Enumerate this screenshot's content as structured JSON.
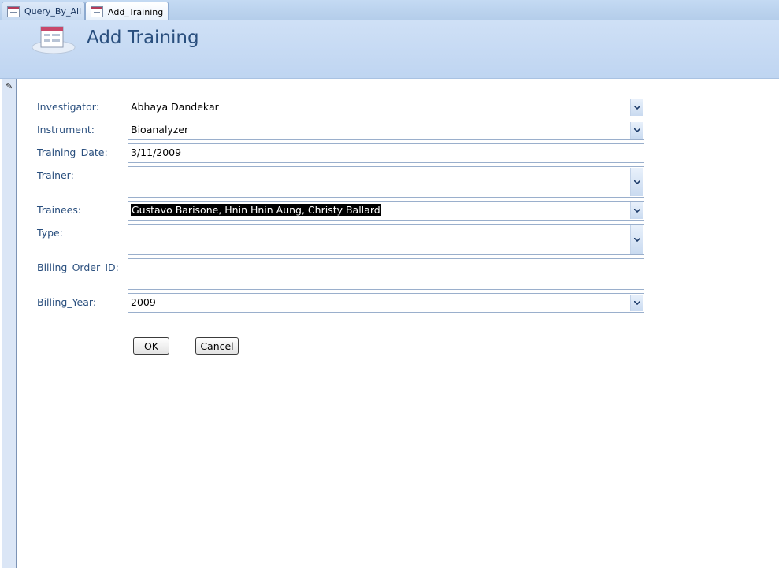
{
  "tabs": [
    {
      "label": "Query_By_All",
      "active": false
    },
    {
      "label": "Add_Training",
      "active": true
    }
  ],
  "header": {
    "title": "Add Training"
  },
  "fields": {
    "investigator": {
      "label": "Investigator:",
      "value": "Abhaya Dandekar",
      "kind": "combo"
    },
    "instrument": {
      "label": "Instrument:",
      "value": "Bioanalyzer",
      "kind": "combo"
    },
    "training_date": {
      "label": "Training_Date:",
      "value": "3/11/2009",
      "kind": "text"
    },
    "trainer": {
      "label": "Trainer:",
      "value": "",
      "kind": "combo"
    },
    "trainees": {
      "label": "Trainees:",
      "value": "Gustavo Barisone, Hnin Hnin Aung, Christy Ballard",
      "kind": "combo",
      "selected": true
    },
    "type": {
      "label": "Type:",
      "value": "",
      "kind": "combo"
    },
    "billing_order_id": {
      "label": "Billing_Order_ID:",
      "value": "",
      "kind": "text"
    },
    "billing_year": {
      "label": "Billing_Year:",
      "value": "2009",
      "kind": "combo"
    }
  },
  "buttons": {
    "ok": "OK",
    "cancel": "Cancel"
  },
  "icons": {
    "tab": "form-icon",
    "header": "form-icon",
    "record_selector": "pencil-icon",
    "dropdown": "chevron-down-icon"
  },
  "colors": {
    "accent": "#2a4f7e",
    "header_bg": "#c8dbf4",
    "selection": "#000000"
  }
}
